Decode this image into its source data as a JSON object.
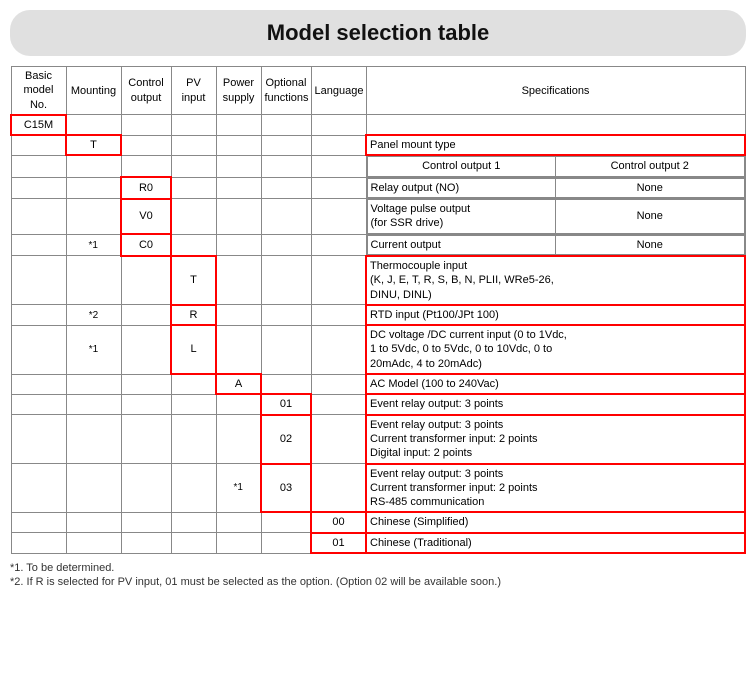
{
  "title": "Model selection table",
  "headers": {
    "basic_model": "Basic\nmodel No.",
    "mounting": "Mounting",
    "control_output": "Control\noutput",
    "pv_input": "PV\ninput",
    "power_supply": "Power\nsupply",
    "optional_functions": "Optional\nfunctions",
    "language": "Language",
    "specifications": "Specifications"
  },
  "notes": [
    "*1. To be determined.",
    "*2. If R is selected for PV input, 01 must be selected as the option. (Option 02 will be available soon.)"
  ],
  "spec_col_headers": {
    "col1": "Control output 1",
    "col2": "Control output 2"
  }
}
